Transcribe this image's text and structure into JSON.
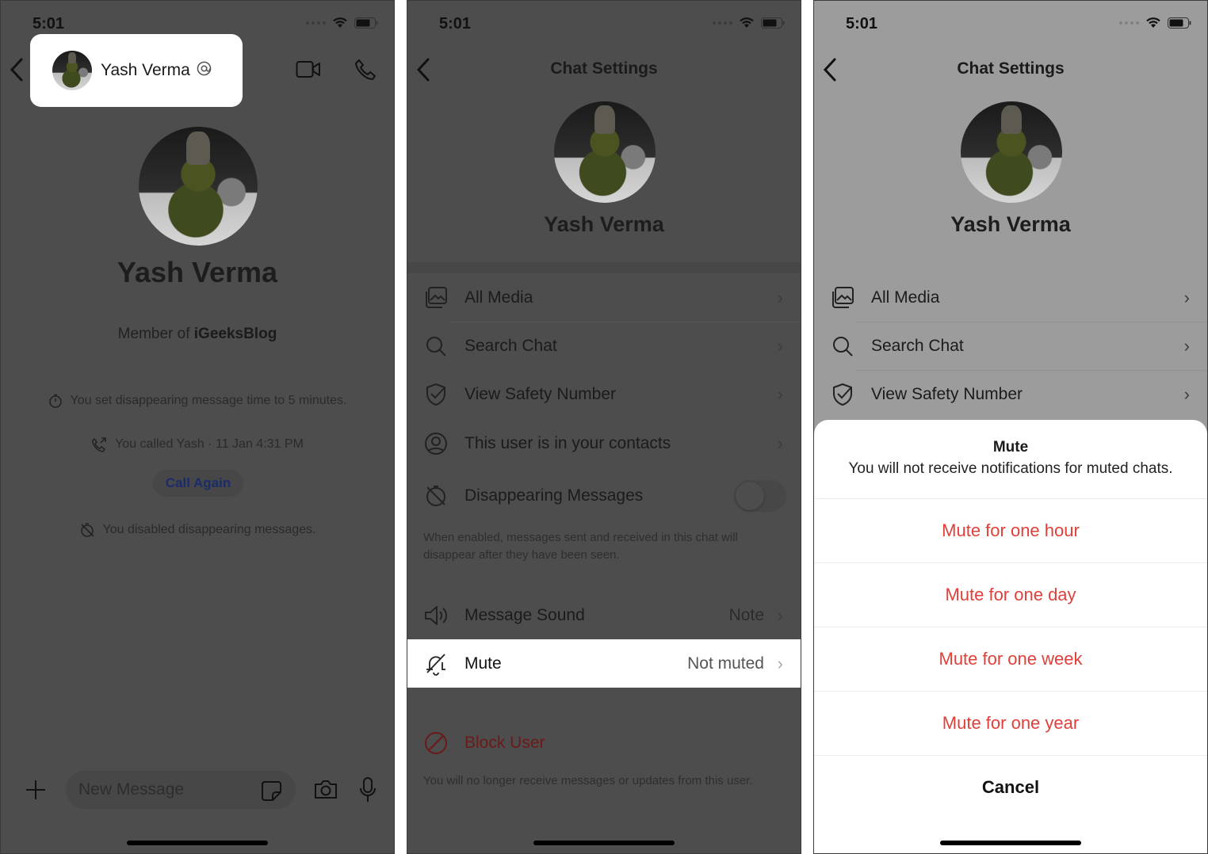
{
  "status_bar": {
    "time": "5:01"
  },
  "panel1": {
    "header": {
      "contact_name": "Yash Verma",
      "at_symbol": "@"
    },
    "profile_name": "Yash Verma",
    "member_prefix": "Member of",
    "member_group": "iGeeksBlog",
    "events": [
      {
        "icon": "timer-icon",
        "text": "You set disappearing message time to 5 minutes."
      },
      {
        "icon": "outgoing-call-icon",
        "text": "You called Yash · 11 Jan 4:31 PM"
      },
      {
        "icon": "timer-off-icon",
        "text": "You disabled disappearing messages."
      }
    ],
    "call_again_label": "Call Again",
    "composer": {
      "placeholder": "New Message"
    }
  },
  "panel2": {
    "title": "Chat Settings",
    "profile_name": "Yash Verma",
    "rows": [
      {
        "icon": "media-icon",
        "label": "All Media"
      },
      {
        "icon": "search-icon",
        "label": "Search Chat"
      },
      {
        "icon": "shield-check-icon",
        "label": "View Safety Number"
      },
      {
        "icon": "contact-icon",
        "label": "This user is in your contacts"
      }
    ],
    "disappearing": {
      "label": "Disappearing Messages",
      "enabled": false,
      "footnote": "When enabled, messages sent and received in this chat will disappear after they have been seen."
    },
    "message_sound": {
      "label": "Message Sound",
      "value": "Note"
    },
    "mute": {
      "label": "Mute",
      "value": "Not muted"
    },
    "block": {
      "label": "Block User",
      "footnote": "You will no longer receive messages or updates from this user."
    }
  },
  "panel3": {
    "title": "Chat Settings",
    "profile_name": "Yash Verma",
    "rows": [
      {
        "icon": "media-icon",
        "label": "All Media"
      },
      {
        "icon": "search-icon",
        "label": "Search Chat"
      },
      {
        "icon": "shield-check-icon",
        "label": "View Safety Number"
      }
    ],
    "sheet": {
      "title": "Mute",
      "message": "You will not receive notifications for muted chats.",
      "options": [
        "Mute for one hour",
        "Mute for one day",
        "Mute for one week",
        "Mute for one year"
      ],
      "cancel_label": "Cancel"
    }
  },
  "colors": {
    "destructive": "#e0403a",
    "dim_overlay": "#4d4d4d",
    "link_blue": "#2c6bed"
  }
}
